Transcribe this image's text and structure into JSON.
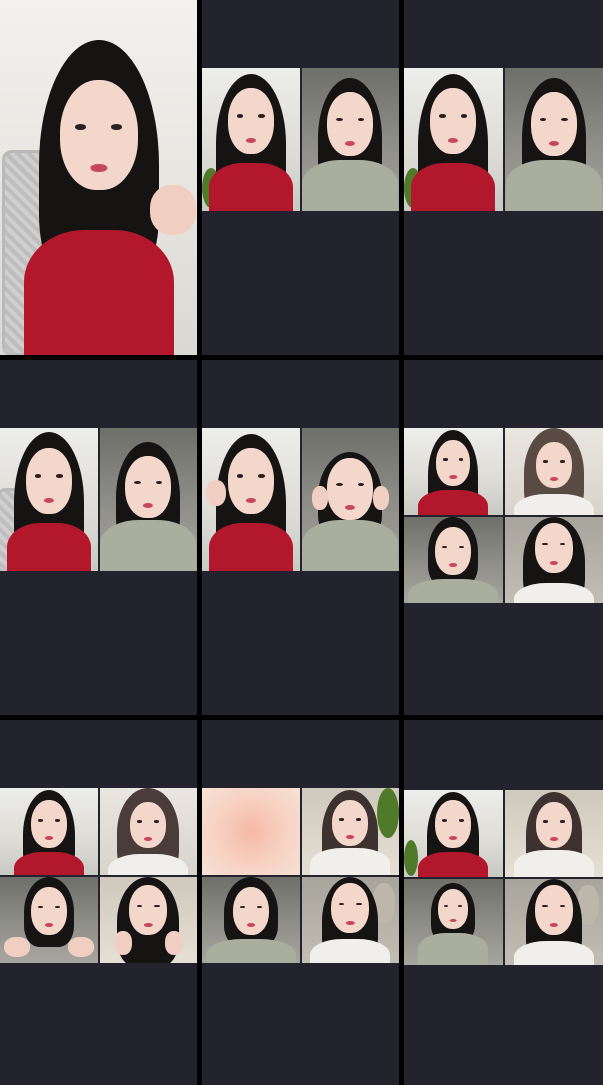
{
  "screen": {
    "layout": "video-call-grid",
    "cells": 9,
    "background_color": "#000000",
    "cell_color": "#23232d"
  },
  "icons": [],
  "overlay_text": {
    "small_caption": ""
  }
}
